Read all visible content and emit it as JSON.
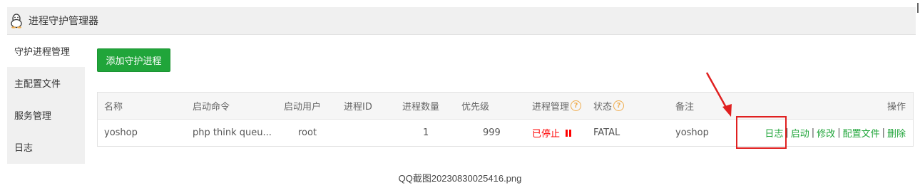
{
  "window": {
    "title": "进程守护管理器",
    "icon": "penguin-icon"
  },
  "sidebar": {
    "items": [
      {
        "label": "守护进程管理"
      },
      {
        "label": "主配置文件"
      },
      {
        "label": "服务管理"
      },
      {
        "label": "日志"
      }
    ]
  },
  "toolbar": {
    "add_label": "添加守护进程"
  },
  "table": {
    "headers": {
      "name": "名称",
      "command": "启动命令",
      "user": "启动用户",
      "pid": "进程ID",
      "count": "进程数量",
      "priority": "优先级",
      "manage": "进程管理",
      "status": "状态",
      "remark": "备注",
      "ops": "操作"
    },
    "help_glyph": "?",
    "rows": [
      {
        "name": "yoshop",
        "command": "php think queu...",
        "user": "root",
        "pid": "",
        "count": "1",
        "priority": "999",
        "manage": "已停止",
        "status": "FATAL",
        "remark": "yoshop",
        "ops": {
          "log": "日志",
          "start": "启动",
          "edit": "修改",
          "config": "配置文件",
          "delete": "删除",
          "sep": "|"
        }
      }
    ]
  },
  "colors": {
    "accent": "#20a53a",
    "danger": "#ff0000",
    "help": "#f0ad4e",
    "annotation": "#e02020"
  },
  "caption": "QQ截图20230830025416.png"
}
